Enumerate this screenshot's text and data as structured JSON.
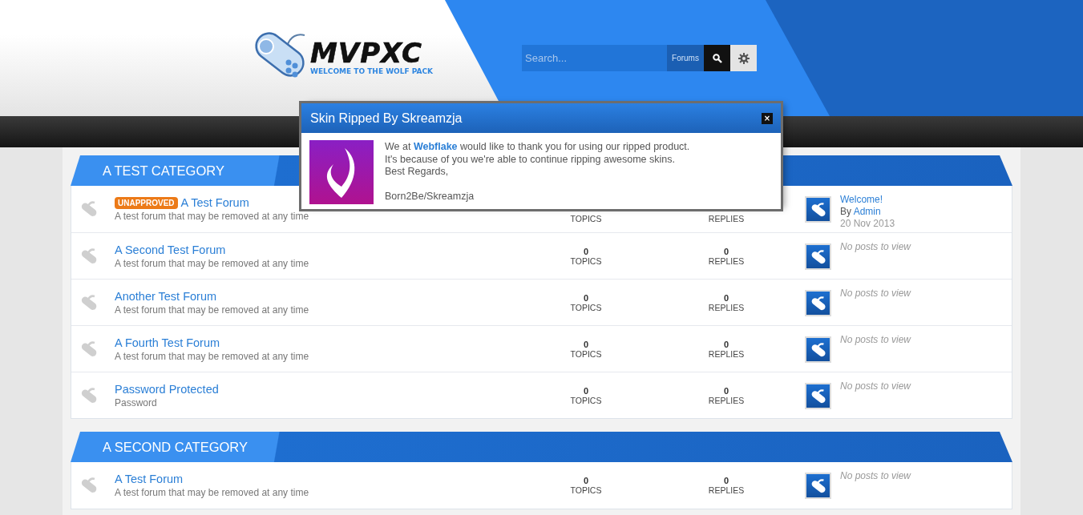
{
  "header": {
    "logo": {
      "title": "MVPXC",
      "tagline": "WELCOME TO THE WOLF PACK"
    },
    "search": {
      "placeholder": "Search...",
      "scope": "Forums"
    }
  },
  "categories": [
    {
      "title": "A TEST CATEGORY",
      "forums": [
        {
          "badge": "UNAPPROVED",
          "title": "A Test Forum",
          "description": "A test forum that may be removed at any time",
          "topics": {
            "label": "TOPICS"
          },
          "replies": {
            "label": "REPLIES"
          },
          "last_post": {
            "kind": "post",
            "title": "Welcome!",
            "by": "By",
            "author": "Admin",
            "date": "20 Nov 2013"
          }
        },
        {
          "title": "A Second Test Forum",
          "description": "A test forum that may be removed at any time",
          "topics": {
            "count": "0",
            "label": "TOPICS"
          },
          "replies": {
            "count": "0",
            "label": "REPLIES"
          },
          "last_post": {
            "kind": "empty",
            "text": "No posts to view"
          }
        },
        {
          "title": "Another Test Forum",
          "description": "A test forum that may be removed at any time",
          "topics": {
            "count": "0",
            "label": "TOPICS"
          },
          "replies": {
            "count": "0",
            "label": "REPLIES"
          },
          "last_post": {
            "kind": "empty",
            "text": "No posts to view"
          }
        },
        {
          "title": "A Fourth Test Forum",
          "description": "A test forum that may be removed at any time",
          "topics": {
            "count": "0",
            "label": "TOPICS"
          },
          "replies": {
            "count": "0",
            "label": "REPLIES"
          },
          "last_post": {
            "kind": "empty",
            "text": "No posts to view"
          }
        },
        {
          "title": "Password Protected",
          "description": "Password",
          "topics": {
            "count": "0",
            "label": "TOPICS"
          },
          "replies": {
            "count": "0",
            "label": "REPLIES"
          },
          "last_post": {
            "kind": "empty",
            "text": "No posts to view"
          }
        }
      ]
    },
    {
      "title": "A SECOND CATEGORY",
      "forums": [
        {
          "title": "A Test Forum",
          "description": "A test forum that may be removed at any time",
          "topics": {
            "count": "0",
            "label": "TOPICS"
          },
          "replies": {
            "count": "0",
            "label": "REPLIES"
          },
          "last_post": {
            "kind": "empty",
            "text": "No posts to view"
          }
        }
      ]
    }
  ],
  "modal": {
    "title": "Skin Ripped By Skreamzja",
    "close": "×",
    "lines": [
      "We at **Webflake** would like to thank you for using our ripped product.",
      "It's because of you we're able to continue ripping awesome skins.",
      "Best Regards,"
    ],
    "signature": "Born2Be/Skreamzja"
  }
}
